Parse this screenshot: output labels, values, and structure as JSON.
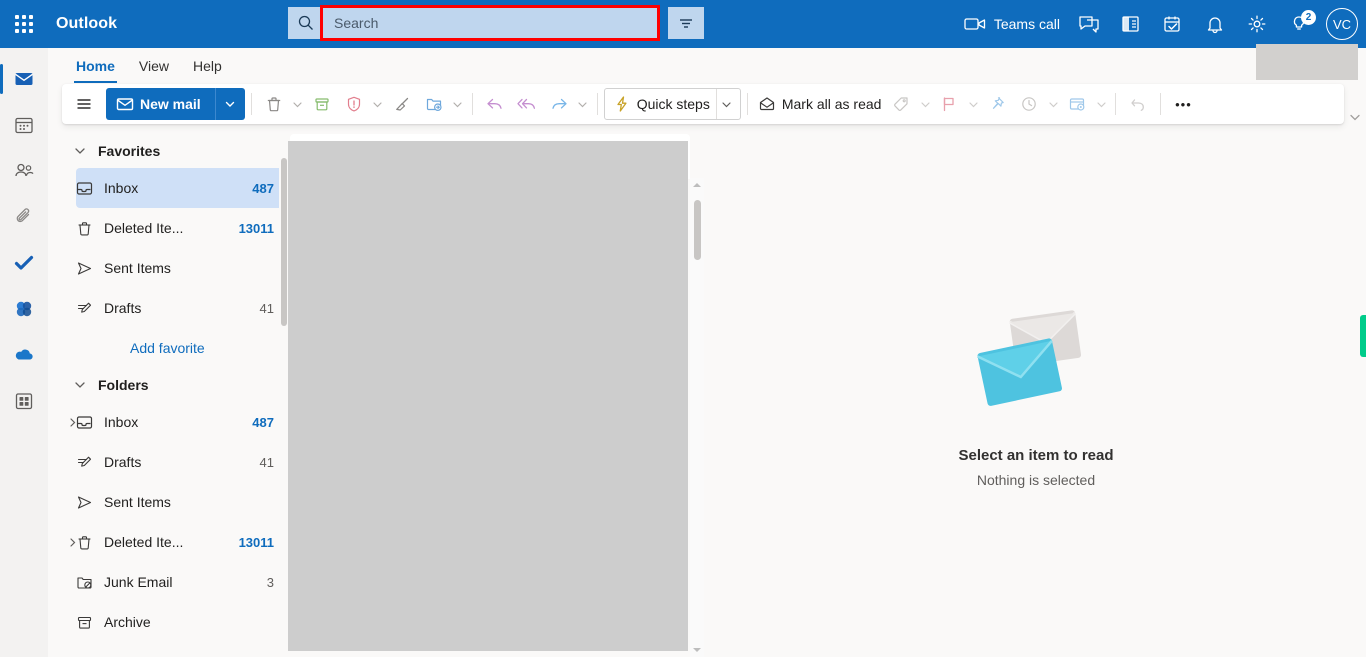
{
  "header": {
    "app_title": "Outlook",
    "waffle_name": "app-launcher",
    "search": {
      "placeholder": "Search",
      "value": "",
      "highlight_color": "#ff0000",
      "search_icon": "search-icon",
      "filter_icon": "filter-icon"
    },
    "actions": [
      {
        "name": "teams-call",
        "label": "Teams call",
        "icon": "video-camera-icon"
      },
      {
        "name": "chat",
        "label": "",
        "icon": "chat-bubble-icon"
      },
      {
        "name": "contacts-card",
        "label": "",
        "icon": "contact-card-icon"
      },
      {
        "name": "my-day",
        "label": "",
        "icon": "calendar-check-icon"
      },
      {
        "name": "notifications",
        "label": "",
        "icon": "bell-icon"
      },
      {
        "name": "settings",
        "label": "",
        "icon": "gear-icon"
      },
      {
        "name": "tips",
        "label": "",
        "icon": "lightbulb-icon",
        "badge": "2"
      }
    ],
    "avatar_initials": "VC",
    "accent_color": "#0f6cbd"
  },
  "rail": {
    "items": [
      {
        "name": "mail",
        "icon": "envelope-icon",
        "active": true
      },
      {
        "name": "calendar",
        "icon": "calendar-icon",
        "active": false
      },
      {
        "name": "people",
        "icon": "people-icon",
        "active": false
      },
      {
        "name": "files",
        "icon": "paperclip-icon",
        "active": false
      },
      {
        "name": "to-do",
        "icon": "checkmark-icon",
        "active": false
      },
      {
        "name": "groups",
        "icon": "groups-flower-icon",
        "active": false
      },
      {
        "name": "onedrive",
        "icon": "cloud-icon",
        "active": false
      },
      {
        "name": "more-apps",
        "icon": "apps-grid-icon",
        "active": false
      }
    ]
  },
  "ribbon": {
    "tabs": [
      {
        "label": "Home",
        "active": true
      },
      {
        "label": "View",
        "active": false
      },
      {
        "label": "Help",
        "active": false
      }
    ]
  },
  "toolbar": {
    "menu_icon": "hamburger-icon",
    "new_mail_label": "New mail",
    "new_mail_icon": "envelope-icon",
    "quick_steps_label": "Quick steps",
    "quick_steps_icon": "lightning-bolt-icon",
    "mark_all_read_label": "Mark all as read",
    "mark_all_read_icon": "open-envelope-icon",
    "buttons": [
      {
        "name": "delete",
        "icon": "trash-icon",
        "caret": true
      },
      {
        "name": "archive",
        "icon": "archive-box-icon",
        "caret": false
      },
      {
        "name": "report",
        "icon": "shield-warning-icon",
        "caret": true
      },
      {
        "name": "sweep",
        "icon": "broom-icon",
        "caret": false
      },
      {
        "name": "move-to",
        "icon": "folder-arrow-icon",
        "caret": true
      },
      {
        "name": "reply",
        "icon": "reply-arrow-icon",
        "caret": false
      },
      {
        "name": "reply-all",
        "icon": "reply-all-arrow-icon",
        "caret": false
      },
      {
        "name": "forward",
        "icon": "forward-arrow-icon",
        "caret": true
      }
    ],
    "trailing_buttons": [
      {
        "name": "tag",
        "icon": "tag-icon",
        "caret": true
      },
      {
        "name": "flag",
        "icon": "flag-icon",
        "caret": true
      },
      {
        "name": "pin",
        "icon": "pin-icon",
        "caret": false
      },
      {
        "name": "snooze",
        "icon": "clock-icon",
        "caret": true
      },
      {
        "name": "rules",
        "icon": "rules-icon",
        "caret": true
      },
      {
        "name": "undo",
        "icon": "undo-arrow-icon",
        "caret": false
      }
    ],
    "more_label": "•••"
  },
  "sidebar": {
    "favorites": {
      "section_label": "Favorites",
      "items": [
        {
          "label": "Inbox",
          "count": "487",
          "icon": "inbox-icon",
          "selected": true,
          "expandable": false,
          "count_style": "accent"
        },
        {
          "label": "Deleted Ite...",
          "count": "13011",
          "icon": "trash-icon",
          "selected": false,
          "expandable": false,
          "count_style": "accent"
        },
        {
          "label": "Sent Items",
          "count": "",
          "icon": "send-icon",
          "selected": false,
          "expandable": false,
          "count_style": "accent"
        },
        {
          "label": "Drafts",
          "count": "41",
          "icon": "draft-pencil-icon",
          "selected": false,
          "expandable": false,
          "count_style": "plain"
        }
      ],
      "add_favorite_label": "Add favorite"
    },
    "folders": {
      "section_label": "Folders",
      "items": [
        {
          "label": "Inbox",
          "count": "487",
          "icon": "inbox-icon",
          "expandable": true,
          "count_style": "accent"
        },
        {
          "label": "Drafts",
          "count": "41",
          "icon": "draft-pencil-icon",
          "expandable": false,
          "count_style": "plain"
        },
        {
          "label": "Sent Items",
          "count": "",
          "icon": "send-icon",
          "expandable": false,
          "count_style": "accent"
        },
        {
          "label": "Deleted Ite...",
          "count": "13011",
          "icon": "trash-icon",
          "expandable": true,
          "count_style": "accent"
        },
        {
          "label": "Junk Email",
          "count": "3",
          "icon": "junk-folder-icon",
          "expandable": false,
          "count_style": "plain"
        },
        {
          "label": "Archive",
          "count": "",
          "icon": "archive-box-icon",
          "expandable": false,
          "count_style": "plain"
        }
      ]
    }
  },
  "reading_pane": {
    "empty_title": "Select an item to read",
    "empty_subtitle": "Nothing is selected",
    "art_name": "two-envelopes-illustration",
    "art_colors": {
      "front": "#4ec3e0",
      "back": "#dedbd9"
    }
  }
}
